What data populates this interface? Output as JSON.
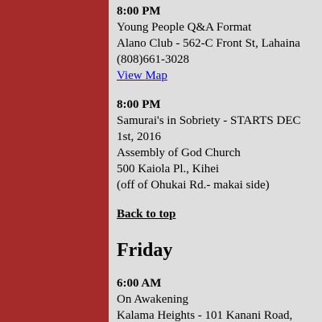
{
  "meetings_before": [
    {
      "time": "8:00 PM",
      "lines": [
        "Young People Q&A Format",
        "Alano Club - 562-C Front St, Lahaina",
        "(808)661-3028"
      ],
      "map_link": "View Map"
    },
    {
      "time": "8:00 PM",
      "lines": [
        "Samurai's in Sobriety - STARTS DEC 1st, 2016",
        "Assembly of God Church",
        "500 Kaiola Pl., Kihei",
        "(off of Ohukai Rd.- makai side)"
      ]
    }
  ],
  "back_to_top": "Back to top",
  "next_day": {
    "heading": "Friday",
    "meetings": [
      {
        "time": "6:00 AM",
        "lines": [
          "On Awakening",
          "Kalama Heights - 101 Kanani Road,"
        ]
      }
    ]
  },
  "colors": {
    "background": "#a52a2a",
    "content_panel": "#dedede",
    "link": "#0000ee"
  }
}
